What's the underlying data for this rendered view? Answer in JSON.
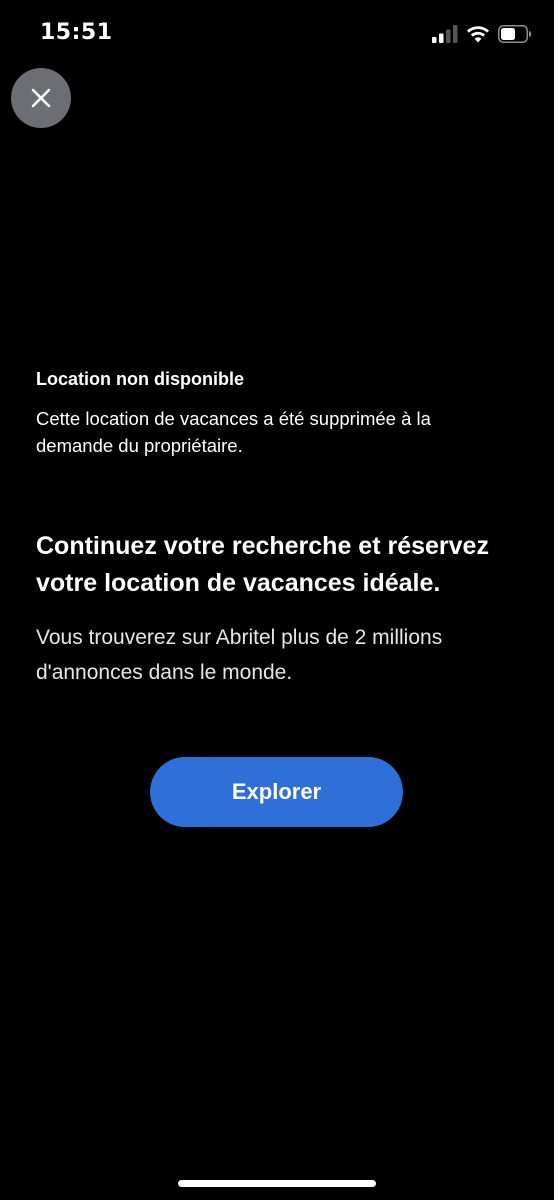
{
  "status_bar": {
    "time": "15:51",
    "icons": [
      "cellular-signal-icon",
      "wifi-icon",
      "battery-icon"
    ]
  },
  "close_button": {
    "icon": "close-icon"
  },
  "notice": {
    "title": "Location non disponible",
    "body": "Cette location de vacances a été supprimée à la demande du propriétaire."
  },
  "promo": {
    "headline": "Continuez votre recherche et réservez votre location de vacances idéale.",
    "subtext": "Vous trouverez sur Abritel plus de 2 millions d'annonces dans le monde."
  },
  "explore_button": {
    "label": "Explorer"
  },
  "colors": {
    "background": "#000000",
    "button_primary": "#2f6fd8",
    "close_button_bg": "#6b6e72",
    "text": "#ffffff"
  }
}
